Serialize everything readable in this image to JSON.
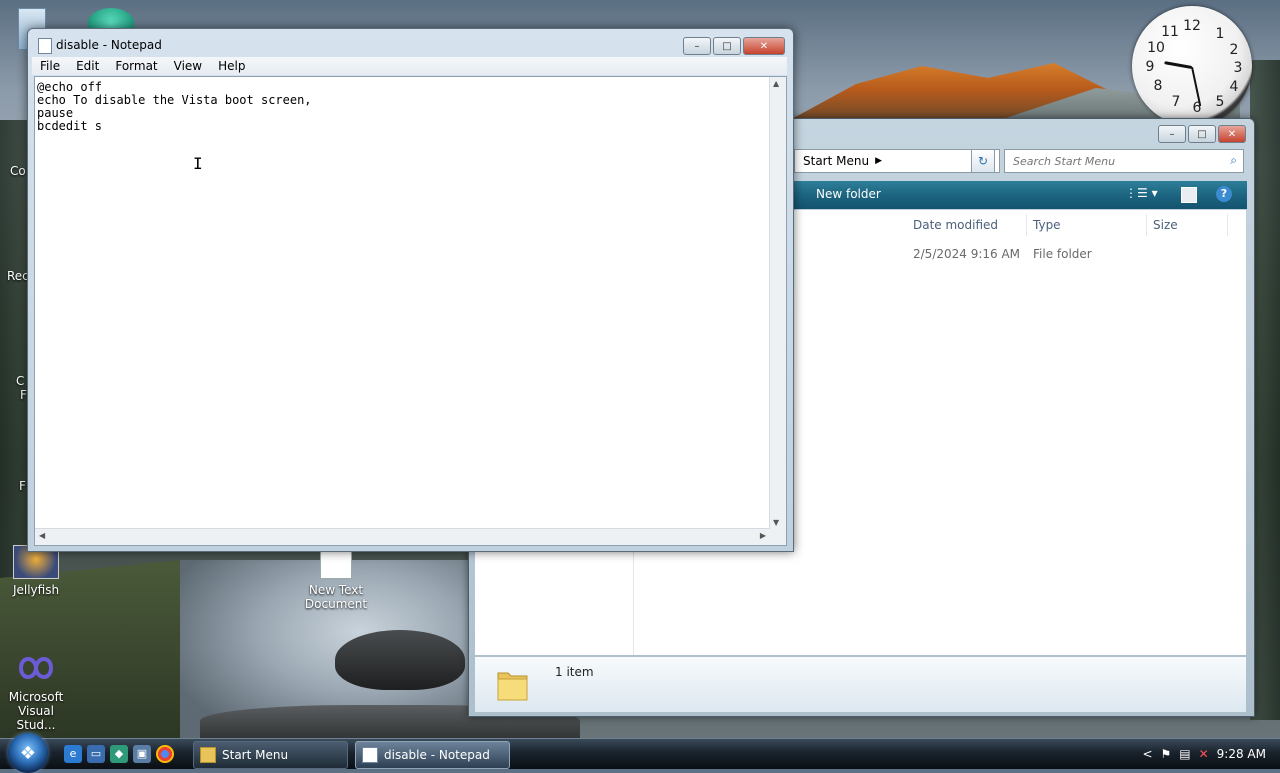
{
  "notepad": {
    "title": "disable - Notepad",
    "menu": [
      "File",
      "Edit",
      "Format",
      "View",
      "Help"
    ],
    "content": "@echo off\necho To disable the Vista boot screen,\npause\nbcdedit s",
    "minimize": "–",
    "maximize": "□",
    "close": "✕"
  },
  "explorer": {
    "address_crumb": "Start Menu",
    "search_placeholder": "Search Start Menu",
    "toolbar_new_folder": "New folder",
    "columns": [
      "Date modified",
      "Type",
      "Size"
    ],
    "rows": [
      {
        "date_modified": "2/5/2024 9:16 AM",
        "type": "File folder",
        "size": ""
      }
    ],
    "status_count": "1 item",
    "help_label": "?"
  },
  "desktop": {
    "icons": [
      {
        "label": "Jellyfish"
      },
      {
        "label": "New Text Document"
      },
      {
        "label": "Microsoft Visual Stud..."
      }
    ],
    "partial_labels": [
      "Co",
      "Rec",
      "C",
      "F",
      "F"
    ]
  },
  "clock": {
    "numbers": [
      "12",
      "1",
      "2",
      "3",
      "4",
      "5",
      "6",
      "7",
      "8",
      "9",
      "10",
      "11"
    ]
  },
  "taskbar": {
    "tasks": [
      {
        "label": "Start Menu",
        "active": false
      },
      {
        "label": "disable - Notepad",
        "active": true
      }
    ],
    "time": "9:28 AM",
    "tray_arrow": "<"
  },
  "colors": {
    "taskbar_bg": "#1a232c",
    "cmdbar_accent": "#1c6580",
    "close_button": "#c5432d"
  },
  "icons": {
    "start": "windows-logo-icon",
    "quick_launch": [
      "internet-explorer-icon",
      "show-desktop-icon",
      "switch-windows-icon",
      "computer-icon",
      "chrome-icon"
    ],
    "tray": [
      "flag-icon",
      "network-icon",
      "volume-muted-icon"
    ]
  }
}
